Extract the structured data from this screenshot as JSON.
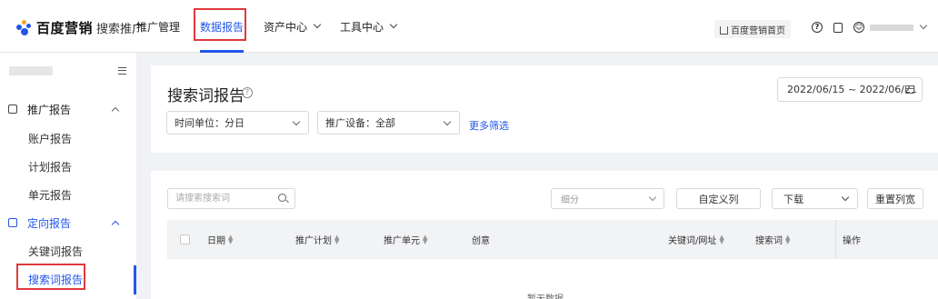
{
  "header": {
    "brand": "百度营销",
    "product": "搜索推广",
    "nav": [
      {
        "label": "推广管理"
      },
      {
        "label": "数据报告",
        "active": true
      },
      {
        "label": "资产中心"
      },
      {
        "label": "工具中心"
      }
    ],
    "home_button": "百度营销首页",
    "icons": [
      "house-icon",
      "help-circle-icon",
      "copy-icon",
      "user-circle-icon",
      "chevron-down-icon"
    ]
  },
  "sidebar": {
    "groups": [
      {
        "label": "推广报告",
        "icon": "report-icon",
        "items": [
          "账户报告",
          "计划报告",
          "单元报告"
        ]
      },
      {
        "label": "定向报告",
        "icon": "target-report-icon",
        "items": [
          "关键词报告",
          "搜索词报告"
        ],
        "active_item": "搜索词报告"
      }
    ]
  },
  "filters": {
    "page_title": "搜索词报告",
    "date_range": "2022/06/15 ~ 2022/06/21",
    "time_unit": "时间单位：分日",
    "device": "推广设备：全部",
    "more_filters": "更多筛选"
  },
  "table": {
    "search_placeholder": "请搜索搜索词",
    "segment_placeholder": "细分",
    "custom_columns": "自定义列",
    "download": "下载",
    "reset_width": "重置列宽",
    "columns": [
      {
        "label": "日期",
        "sortable": true
      },
      {
        "label": "推广计划",
        "sortable": true
      },
      {
        "label": "推广单元",
        "sortable": true
      },
      {
        "label": "创意",
        "sortable": false
      },
      {
        "label": "关键词/网址",
        "sortable": true
      },
      {
        "label": "搜索词",
        "sortable": true
      },
      {
        "label": "操作",
        "sortable": false
      }
    ],
    "empty_text": "暂无数据"
  },
  "colors": {
    "accent": "#2156e9",
    "highlight_box": "#e0393e",
    "background": "#f0f2f5"
  }
}
